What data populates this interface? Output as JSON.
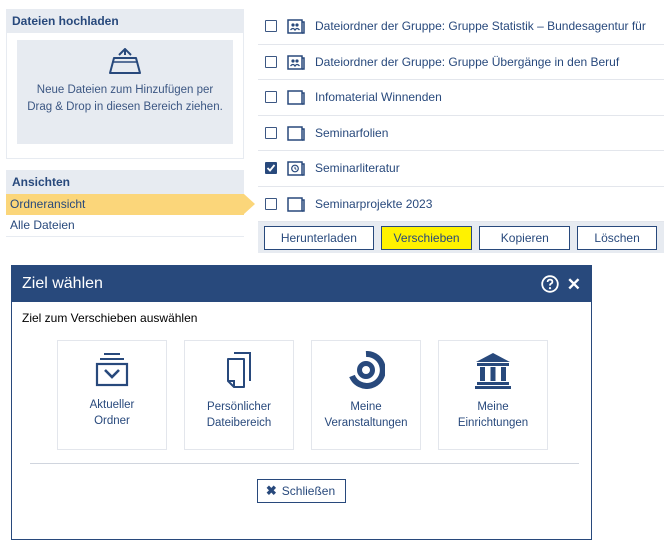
{
  "sidebar": {
    "upload": {
      "heading": "Dateien hochladen",
      "hint_line1": "Neue Dateien zum Hinzufügen per",
      "hint_line2": "Drag & Drop in diesen Bereich ziehen."
    },
    "views": {
      "heading": "Ansichten",
      "items": [
        {
          "label": "Ordneransicht",
          "active": true
        },
        {
          "label": "Alle Dateien",
          "active": false
        }
      ]
    }
  },
  "files": {
    "rows": [
      {
        "name": "Dateiordner der Gruppe: Gruppe Statistik – Bundesagentur für",
        "icon": "group-folder-icon",
        "checked": false
      },
      {
        "name": "Dateiordner der Gruppe: Gruppe Übergänge in den Beruf",
        "icon": "group-folder-icon",
        "checked": false
      },
      {
        "name": "Infomaterial Winnenden",
        "icon": "folder-icon",
        "checked": false
      },
      {
        "name": "Seminarfolien",
        "icon": "folder-icon",
        "checked": false
      },
      {
        "name": "Seminarliteratur",
        "icon": "timed-folder-icon",
        "checked": true
      },
      {
        "name": "Seminarprojekte 2023",
        "icon": "folder-icon",
        "checked": false
      }
    ],
    "actions": {
      "download": "Herunterladen",
      "move": "Verschieben",
      "copy": "Kopieren",
      "delete": "Löschen"
    }
  },
  "dialog": {
    "title": "Ziel wählen",
    "subtitle": "Ziel zum Verschieben auswählen",
    "targets": [
      {
        "line1": "Aktueller",
        "line2": "Ordner",
        "icon": "current-folder-icon"
      },
      {
        "line1": "Persönlicher",
        "line2": "Dateibereich",
        "icon": "personal-files-icon"
      },
      {
        "line1": "Meine",
        "line2": "Veranstaltungen",
        "icon": "courses-icon"
      },
      {
        "line1": "Meine",
        "line2": "Einrichtungen",
        "icon": "institute-icon"
      }
    ],
    "close_label": "Schließen"
  },
  "colors": {
    "brand": "#28497c",
    "panel": "#e7ebf1",
    "active_view": "#fbd67a",
    "highlight": "#fff200"
  }
}
